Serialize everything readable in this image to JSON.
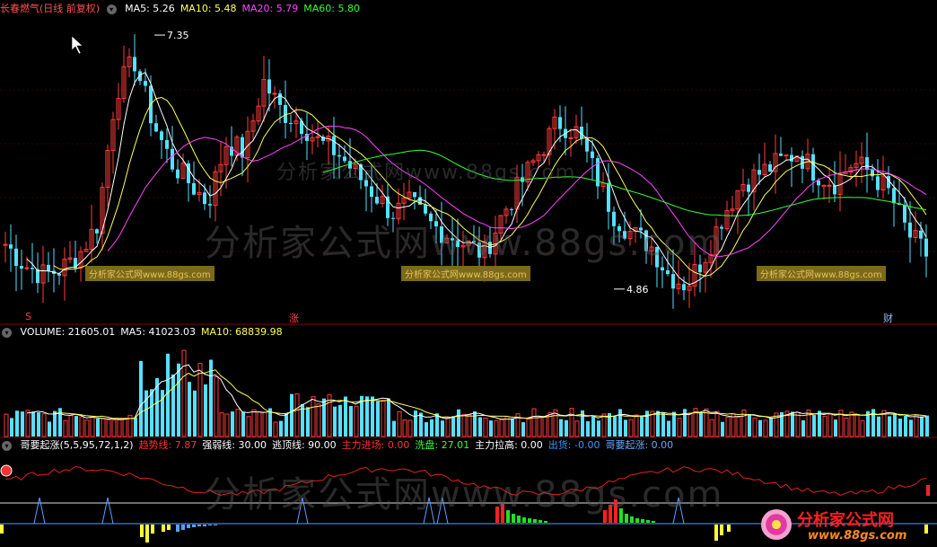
{
  "price_panel": {
    "title": "长春燃气(日线 前复权)",
    "ma": [
      {
        "label": "MA5: 5.26",
        "color": "#ffffff"
      },
      {
        "label": "MA10: 5.48",
        "color": "#ffff55"
      },
      {
        "label": "MA20: 5.79",
        "color": "#ff44ff"
      },
      {
        "label": "MA60: 5.80",
        "color": "#33ff33"
      }
    ],
    "high_label": "7.35",
    "low_label": "4.86",
    "markers": {
      "s": "S",
      "zhang": "涨",
      "cai": "财"
    },
    "tag_text": "分析家公式网www.88gs.com",
    "watermark_large": "分析家公式网www.88gs.com",
    "watermark_small": "分析家公式网www.88gs.com"
  },
  "volume_panel": {
    "legend": [
      {
        "label": "VOLUME: 21605.01",
        "color": "#ffffff"
      },
      {
        "label": "MA5: 41023.03",
        "color": "#ffffff"
      },
      {
        "label": "MA10: 68839.98",
        "color": "#ffff55"
      }
    ]
  },
  "indicator_panel": {
    "legend": [
      {
        "label": "哥要起涨(5,5,95,72,1,2)",
        "color": "#ffffff"
      },
      {
        "label": "趋势线: 7.87",
        "color": "#ff3333"
      },
      {
        "label": "强弱线: 30.00",
        "color": "#ffffff"
      },
      {
        "label": "逃顶线: 90.00",
        "color": "#ffffff"
      },
      {
        "label": "主力进场: 0.00",
        "color": "#ff3333"
      },
      {
        "label": "洗盘: 27.01",
        "color": "#33ff33"
      },
      {
        "label": "主力拉高: 0.00",
        "color": "#ffffff"
      },
      {
        "label": "出货: -0.00",
        "color": "#3399ff"
      },
      {
        "label": "哥要起涨: 0.00",
        "color": "#66aaff"
      }
    ],
    "watermark": "分析家公式网www.88gs.com"
  },
  "logo": {
    "name": "分析家公式网",
    "url": "www.88gs.com"
  },
  "chart_data": {
    "type": "candlestick",
    "price_ylim": [
      4.7,
      7.5
    ],
    "high": 7.35,
    "low": 4.86,
    "close_path": [
      5.3,
      5.1,
      5.0,
      5.05,
      5.2,
      5.5,
      6.8,
      7.1,
      6.5,
      6.1,
      5.9,
      5.7,
      6.3,
      6.2,
      6.9,
      6.6,
      6.5,
      6.3,
      6.2,
      6.0,
      5.8,
      5.6,
      5.7,
      5.5,
      5.4,
      5.3,
      5.2,
      5.6,
      5.9,
      6.2,
      6.5,
      6.4,
      6.0,
      5.6,
      5.4,
      5.3,
      5.0,
      4.9,
      5.2,
      5.6,
      5.9,
      6.0,
      6.1,
      6.2,
      6.0,
      5.9,
      6.1,
      6.0,
      5.8,
      5.4,
      5.2
    ]
  }
}
